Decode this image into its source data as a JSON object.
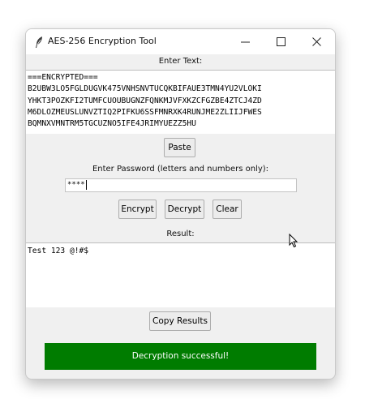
{
  "window": {
    "title": "AES-256 Encryption Tool",
    "icon": "feather-icon",
    "controls": [
      "minimize-icon",
      "maximize-icon",
      "close-icon"
    ]
  },
  "input": {
    "label": "Enter Text:",
    "text": "===ENCRYPTED===\nB2UBW3LO5FGLDUGVK475VNHSNVTUCQKBIFAUE3TMN4YU2VLOKI\nYHKT3POZKFI2TUMFCUOUBUGNZFQNKMJVFXKZCFGZBE4ZTCJ4ZD\nM6DLOZMEUSLUNVZTIQ2PIFKU6SSFMNRXK4RUNJME2ZLIIJFWES\nBQMNXVMNTRM5TGCUZNO5IFE4JRIMYUEZZ5HU"
  },
  "paste_button": "Paste",
  "password": {
    "label": "Enter Password (letters and numbers only):",
    "value": "****"
  },
  "actions": {
    "encrypt": "Encrypt",
    "decrypt": "Decrypt",
    "clear": "Clear"
  },
  "result": {
    "label": "Result:",
    "text": "Test 123 @!#$"
  },
  "copy_button": "Copy Results",
  "status": {
    "message": "Decryption successful!",
    "color": "#007c00"
  }
}
